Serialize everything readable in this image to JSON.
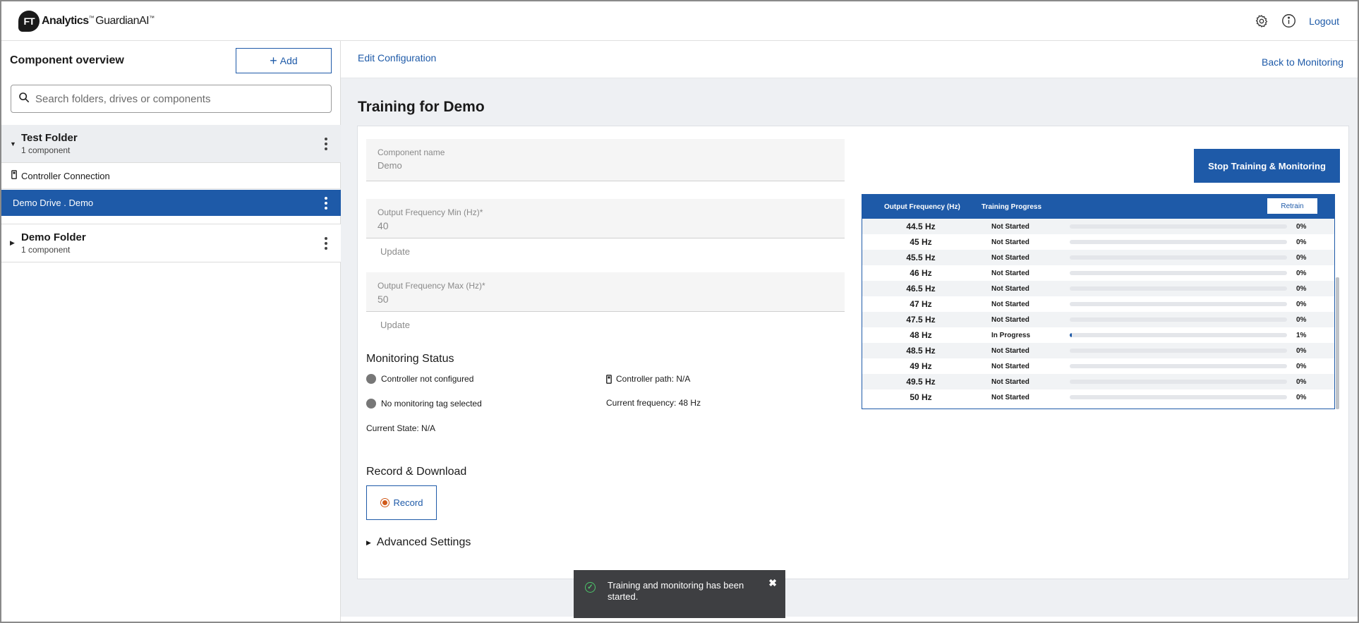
{
  "header": {
    "logo_badge": "FT",
    "logo_brand": "Analytics",
    "logo_tm": "™",
    "logo_product": "GuardianAI",
    "logo_product_tm": "™",
    "logout": "Logout"
  },
  "sidebar": {
    "title": "Component overview",
    "add_label": "Add",
    "search_placeholder": "Search folders, drives or components",
    "folders": [
      {
        "name": "Test Folder",
        "count": "1 component"
      },
      {
        "name": "Demo Folder",
        "count": "1 component"
      }
    ],
    "controller_connection": "Controller Connection",
    "selected_drive": "Demo Drive . Demo"
  },
  "main": {
    "edit_configuration": "Edit Configuration",
    "back_to_monitoring": "Back to Monitoring",
    "title": "Training for Demo",
    "component_name_label": "Component name",
    "component_name_value": "Demo",
    "freq_min_label": "Output Frequency Min (Hz)*",
    "freq_min_value": "40",
    "freq_max_label": "Output Frequency Max (Hz)*",
    "freq_max_value": "50",
    "update_label": "Update",
    "monitoring_status_title": "Monitoring Status",
    "controller_status": "Controller not configured",
    "tag_status": "No monitoring tag selected",
    "current_state": "Current State: N/A",
    "controller_path": "Controller path: N/A",
    "current_frequency": "Current frequency: 48 Hz",
    "record_download_title": "Record & Download",
    "record_label": "Record",
    "advanced_settings": "Advanced Settings",
    "stop_button": "Stop Training & Monitoring"
  },
  "training_table": {
    "col_frequency": "Output Frequency (Hz)",
    "col_progress": "Training Progress",
    "retrain_label": "Retrain",
    "rows": [
      {
        "freq": "44.5 Hz",
        "status": "Not Started",
        "pct": "0%",
        "progress": 0
      },
      {
        "freq": "45 Hz",
        "status": "Not Started",
        "pct": "0%",
        "progress": 0
      },
      {
        "freq": "45.5 Hz",
        "status": "Not Started",
        "pct": "0%",
        "progress": 0
      },
      {
        "freq": "46 Hz",
        "status": "Not Started",
        "pct": "0%",
        "progress": 0
      },
      {
        "freq": "46.5 Hz",
        "status": "Not Started",
        "pct": "0%",
        "progress": 0
      },
      {
        "freq": "47 Hz",
        "status": "Not Started",
        "pct": "0%",
        "progress": 0
      },
      {
        "freq": "47.5 Hz",
        "status": "Not Started",
        "pct": "0%",
        "progress": 0
      },
      {
        "freq": "48 Hz",
        "status": "In Progress",
        "pct": "1%",
        "progress": 1
      },
      {
        "freq": "48.5 Hz",
        "status": "Not Started",
        "pct": "0%",
        "progress": 0
      },
      {
        "freq": "49 Hz",
        "status": "Not Started",
        "pct": "0%",
        "progress": 0
      },
      {
        "freq": "49.5 Hz",
        "status": "Not Started",
        "pct": "0%",
        "progress": 0
      },
      {
        "freq": "50 Hz",
        "status": "Not Started",
        "pct": "0%",
        "progress": 0
      }
    ]
  },
  "toast": {
    "message": "Training and monitoring has been started.",
    "close": "✖"
  },
  "colors": {
    "accent": "#1e5aa8",
    "toast_bg": "#3e3f42",
    "success": "#4cc66b",
    "record": "#d05a1a"
  },
  "icons": [
    "gear-icon",
    "info-icon",
    "search-icon",
    "plus-icon",
    "caret-down-icon",
    "caret-right-icon",
    "kebab-icon",
    "controller-icon",
    "check-icon",
    "close-icon",
    "record-icon"
  ]
}
